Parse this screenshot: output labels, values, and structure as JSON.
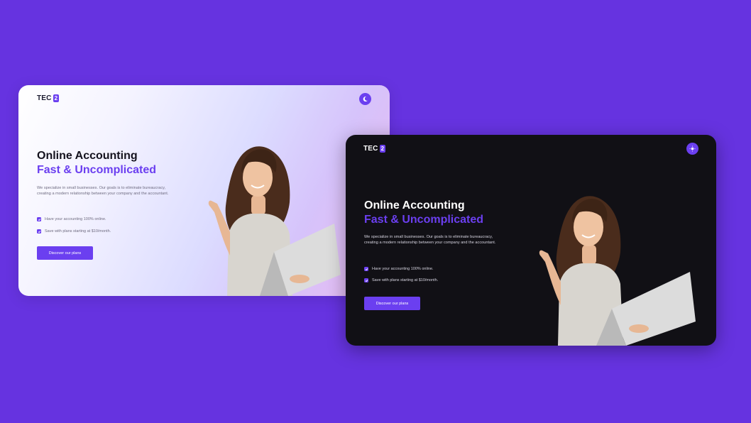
{
  "colors": {
    "page_bg": "#6633e0",
    "accent": "#6b3ff0",
    "dark_card_bg": "#111015"
  },
  "logo": {
    "text": "TEC",
    "badge": "2"
  },
  "light_card": {
    "theme_toggle_icon": "moon-icon",
    "headline_line1": "Online Accounting",
    "headline_line2": "Fast & Uncomplicated",
    "description": "We specialize in small businesses. Our goals is to eliminate bureaucracy, creating a modern relationship between your company and the accountant.",
    "features": [
      {
        "text": "Have your accounting 100% online."
      },
      {
        "text": "Save with plans starting at $10/month."
      }
    ],
    "cta_label": "Discover our plans"
  },
  "dark_card": {
    "theme_toggle_icon": "sun-icon",
    "headline_line1": "Online Accounting",
    "headline_line2": "Fast & Uncomplicated",
    "description": "We specialize in small businesses. Our goals is to eliminate bureaucracy, creating a modern relationship between your company and the accountant.",
    "features": [
      {
        "text": "Have your accounting 100% online."
      },
      {
        "text": "Save with plans starting at $10/month."
      }
    ],
    "cta_label": "Discover our plans"
  }
}
